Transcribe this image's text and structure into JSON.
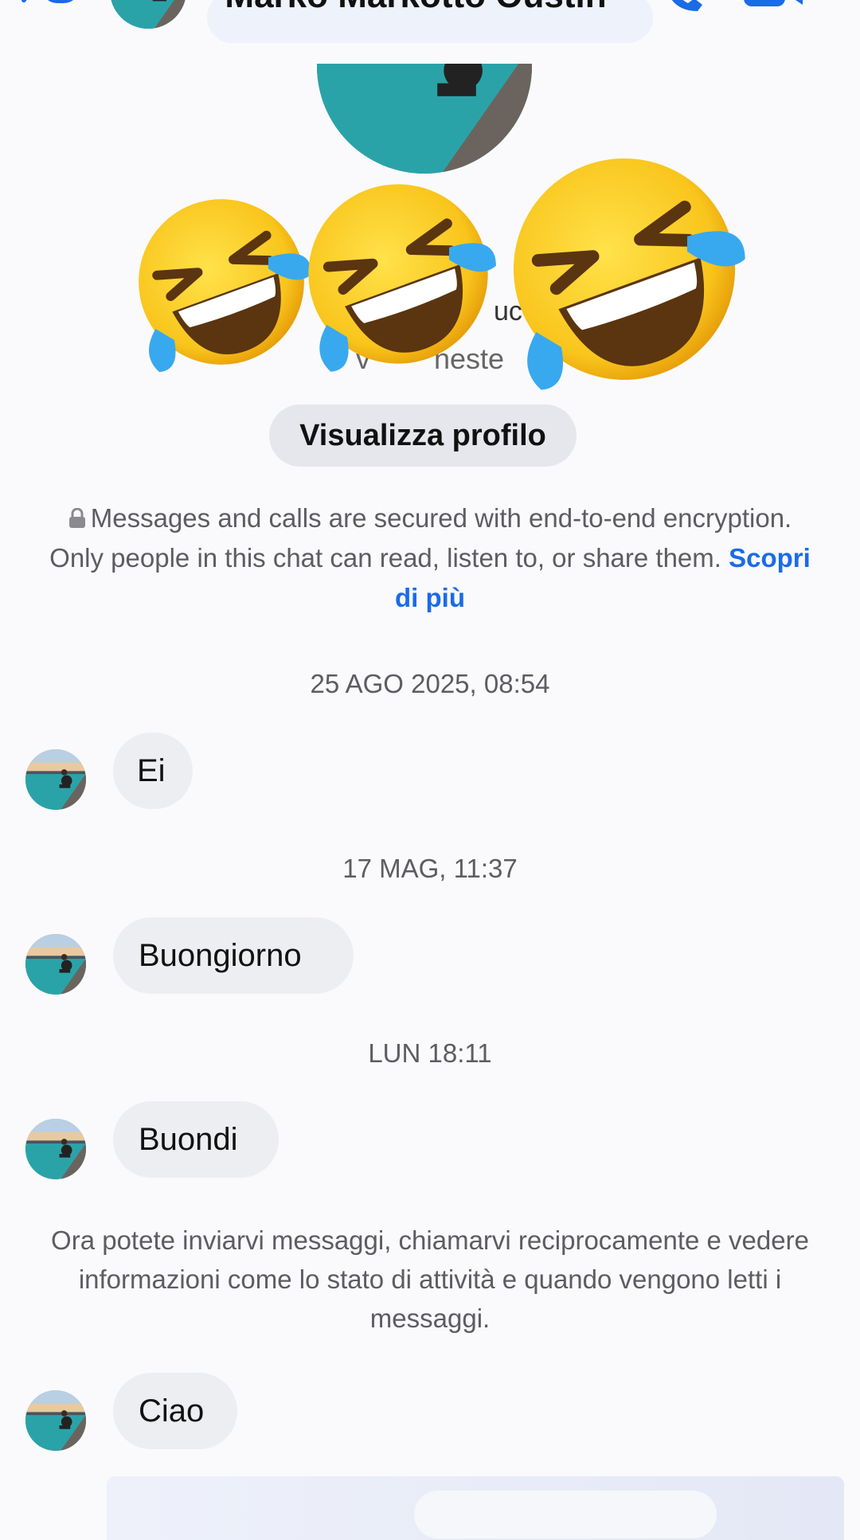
{
  "header": {
    "contact_name": "Marko Markotto Oustin"
  },
  "profile": {
    "name_fragment": "uc",
    "subtitle_fragment": "v        heste",
    "view_profile_label": "Visualizza profilo"
  },
  "encryption": {
    "text": "Messages and calls are secured with end-to-end encryption. Only people in this chat can read, listen to, or share them.",
    "link_label": "Scopri di più"
  },
  "timeline": [
    {
      "timestamp": "25 AGO 2025, 08:54",
      "message": "Ei"
    },
    {
      "timestamp": "17 MAG, 11:37",
      "message": "Buongiorno"
    },
    {
      "timestamp": "LUN 18:11",
      "message": "Buondi"
    }
  ],
  "system_note": "Ora potete inviarvi messaggi, chiamarvi reciprocamente e vedere informazioni come lo stato di attività e quando vengono letti i messaggi.",
  "last_message": "Ciao",
  "colors": {
    "accent": "#1a6be6",
    "bubble": "#eceef1",
    "background": "#fafafc"
  },
  "icons": [
    "back-icon",
    "call-icon",
    "video-call-icon",
    "lock-icon",
    "rofl-emoji"
  ]
}
